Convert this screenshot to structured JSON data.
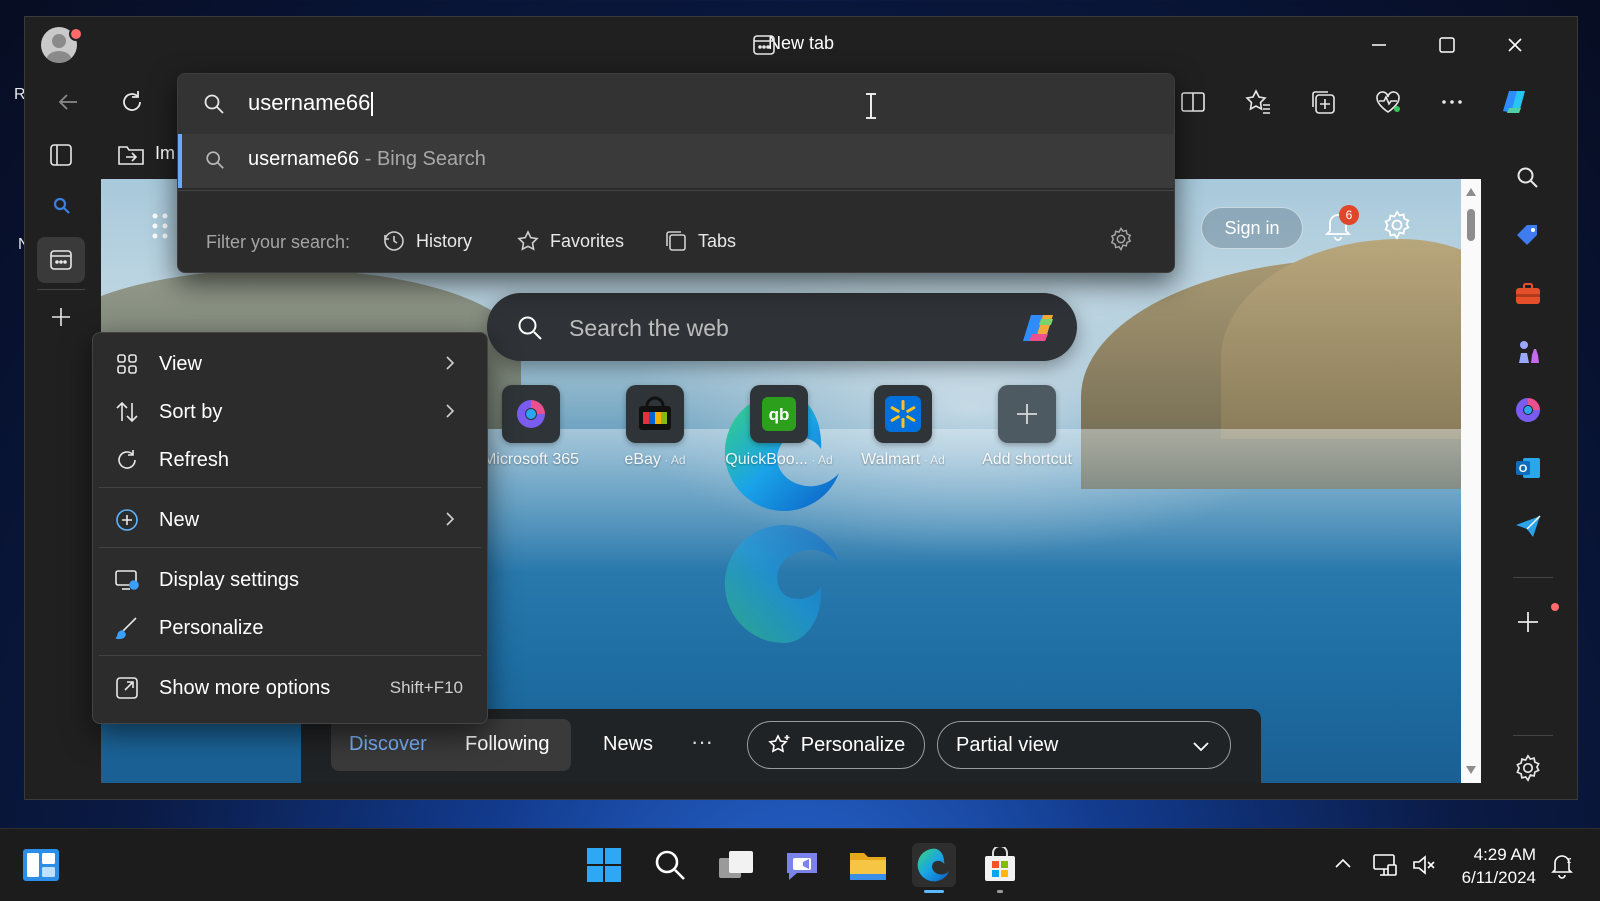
{
  "desktop": {
    "left_letters": [
      "R",
      "N"
    ]
  },
  "browser": {
    "tab_title": "New tab",
    "address_bar": {
      "value": "username66"
    },
    "suggestion": {
      "query": "username66",
      "source": " - Bing Search"
    },
    "filter": {
      "label": "Filter your search:",
      "items": [
        {
          "label": "History",
          "icon": "history-icon"
        },
        {
          "label": "Favorites",
          "icon": "star-icon"
        },
        {
          "label": "Tabs",
          "icon": "tabs-icon"
        }
      ]
    },
    "favorites_bar_partial": "Im"
  },
  "ntp": {
    "signin": "Sign in",
    "notification_count": "6",
    "search_placeholder": "Search the web",
    "shortcuts": [
      {
        "label": "Microsoft 365",
        "ad": ""
      },
      {
        "label": "eBay",
        "ad": " · Ad"
      },
      {
        "label": "QuickBoo...",
        "ad": " · Ad"
      },
      {
        "label": "Walmart",
        "ad": " · Ad"
      },
      {
        "label": "Add shortcut",
        "ad": ""
      }
    ],
    "feed": {
      "discover": "Discover",
      "following": "Following",
      "news": "News",
      "more": "···",
      "personalize": "Personalize",
      "view": "Partial view"
    }
  },
  "context_menu": {
    "view": "View",
    "sort_by": "Sort by",
    "refresh": "Refresh",
    "new": "New",
    "display_settings": "Display settings",
    "personalize": "Personalize",
    "show_more": "Show more options",
    "show_more_shortcut": "Shift+F10"
  },
  "taskbar": {
    "time": "4:29 AM",
    "date": "6/11/2024"
  },
  "colors": {
    "accent": "#6aa8ff",
    "badge": "#e0472a",
    "window_bg": "#202020"
  }
}
